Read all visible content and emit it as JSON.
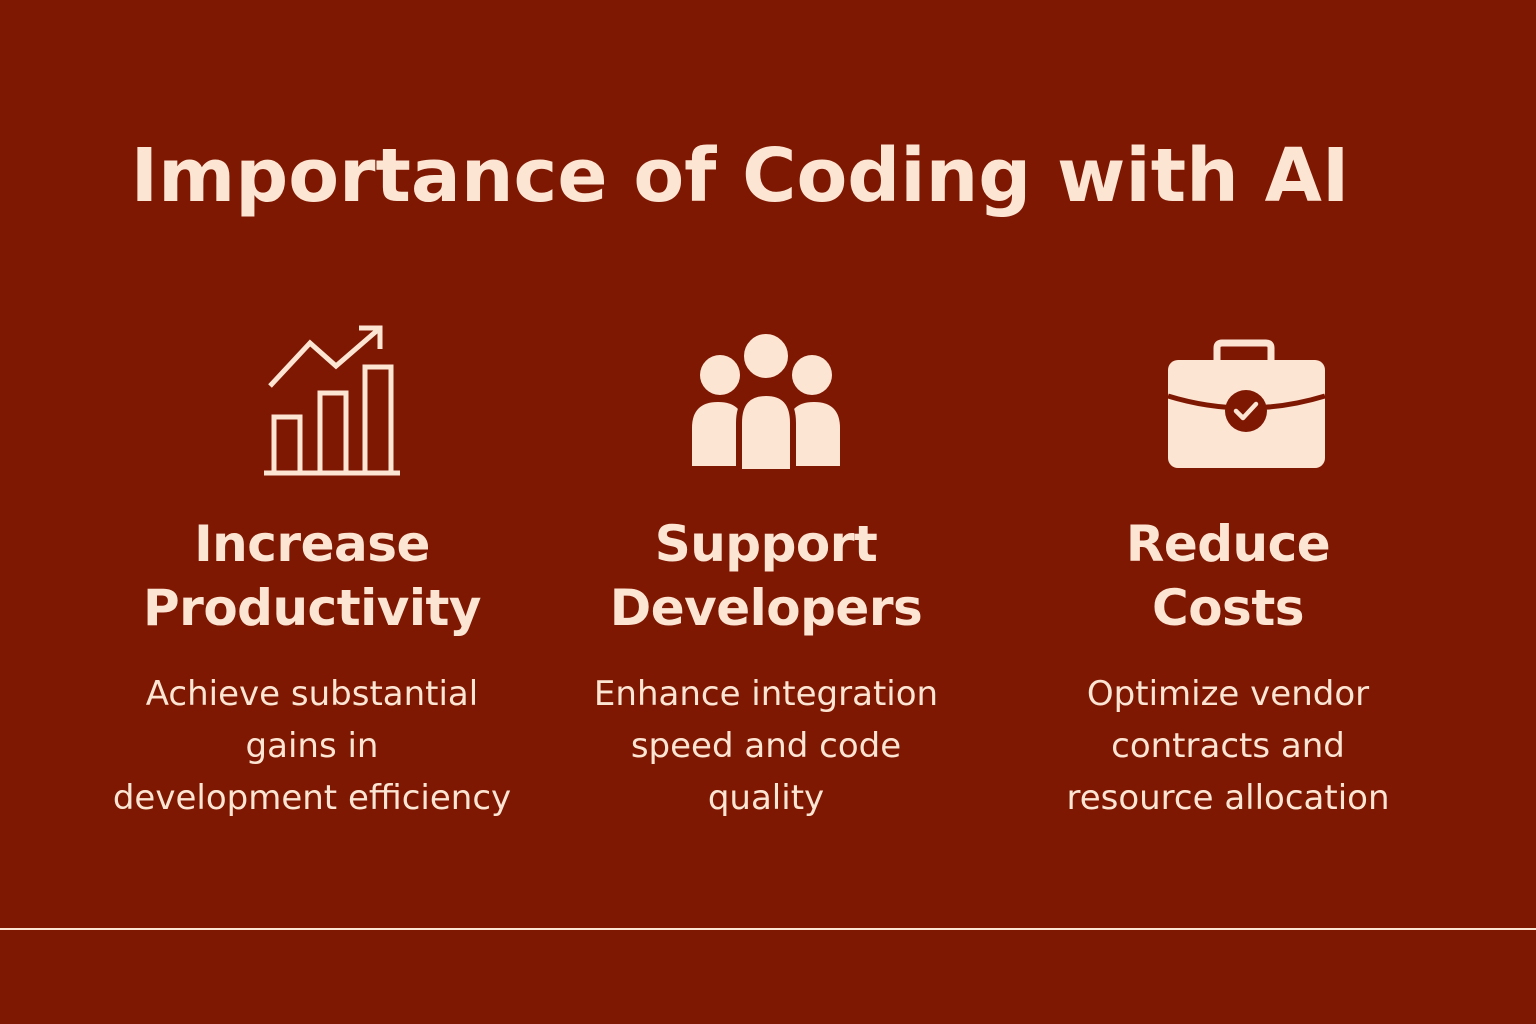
{
  "colors": {
    "background": "#7f1803",
    "foreground": "#fde5d3"
  },
  "title": "Importance of Coding with AI",
  "cards": [
    {
      "icon": "bar-chart-growth-icon",
      "heading_line1": "Increase",
      "heading_line2": "Productivity",
      "desc_line1": "Achieve substantial",
      "desc_line2": "gains in",
      "desc_line3": "development efficiency"
    },
    {
      "icon": "people-group-icon",
      "heading_line1": "Support",
      "heading_line2": "Developers",
      "desc_line1": "Enhance integration",
      "desc_line2": "speed and code",
      "desc_line3": "quality"
    },
    {
      "icon": "briefcase-check-icon",
      "heading_line1": "Reduce",
      "heading_line2": "Costs",
      "desc_line1": "Optimize vendor",
      "desc_line2": "contracts and",
      "desc_line3": "resource allocation"
    }
  ]
}
